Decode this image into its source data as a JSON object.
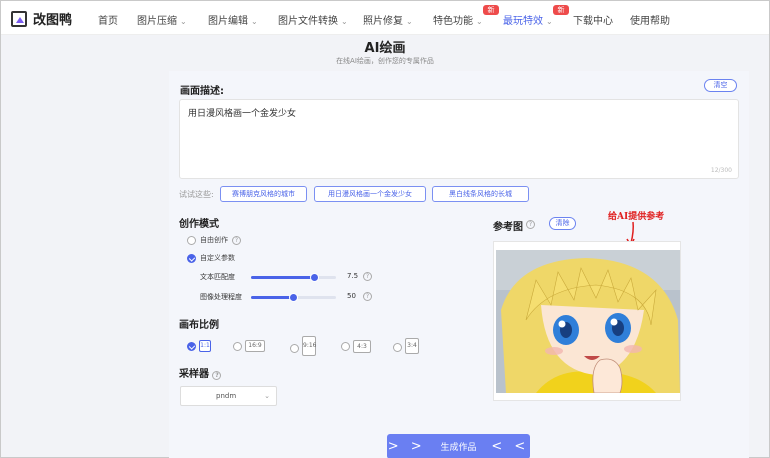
{
  "nav": {
    "logo": "改图鸭",
    "items": [
      {
        "label": "首页",
        "dropdown": false,
        "active": false
      },
      {
        "label": "图片压缩",
        "dropdown": true,
        "active": false
      },
      {
        "label": "图片编辑",
        "dropdown": true,
        "active": false
      },
      {
        "label": "图片文件转换",
        "dropdown": true,
        "active": false
      },
      {
        "label": "照片修复",
        "dropdown": true,
        "active": false
      },
      {
        "label": "特色功能",
        "dropdown": true,
        "active": false,
        "badge": "新"
      },
      {
        "label": "最玩特效",
        "dropdown": true,
        "active": true,
        "badge": "新"
      },
      {
        "label": "下载中心",
        "dropdown": false,
        "active": false
      },
      {
        "label": "使用帮助",
        "dropdown": false,
        "active": false
      }
    ]
  },
  "page": {
    "title": "AI绘画",
    "subtitle": "在线AI绘画，创作您的专属作品"
  },
  "prompt": {
    "label": "画面描述:",
    "clear": "清空",
    "value": "用日漫风格画一个金发少女",
    "counter": "12/300"
  },
  "try": {
    "label": "试试这些:",
    "chips": [
      "赛博朋克风格的城市",
      "用日漫风格画一个金发少女",
      "黑白线条风格的长城"
    ]
  },
  "mode": {
    "label": "创作模式",
    "options": [
      {
        "label": "自由创作",
        "selected": false
      },
      {
        "label": "自定义参数",
        "selected": true
      }
    ],
    "sliders": [
      {
        "label": "文本匹配度",
        "value": "7.5",
        "fraction": 0.75
      },
      {
        "label": "图像处理程度",
        "value": "50",
        "fraction": 0.5
      }
    ]
  },
  "canvas": {
    "label": "画布比例",
    "ratios": [
      {
        "label": "1:1",
        "selected": true
      },
      {
        "label": "16:9",
        "selected": false
      },
      {
        "label": "9:16",
        "selected": false
      },
      {
        "label": "4:3",
        "selected": false
      },
      {
        "label": "3:4",
        "selected": false
      }
    ]
  },
  "sampler": {
    "label": "采样器",
    "value": "pndm"
  },
  "reference": {
    "label": "参考图",
    "clear": "清除",
    "annotation": "给AI提供参考"
  },
  "generate": {
    "label": "生成作品",
    "left_arrows": "> >",
    "right_arrows": "< <"
  },
  "colors": {
    "accent": "#4a63e8",
    "button": "#6a7ff2",
    "badge": "#ee4b4b",
    "annotation": "#e02020"
  }
}
